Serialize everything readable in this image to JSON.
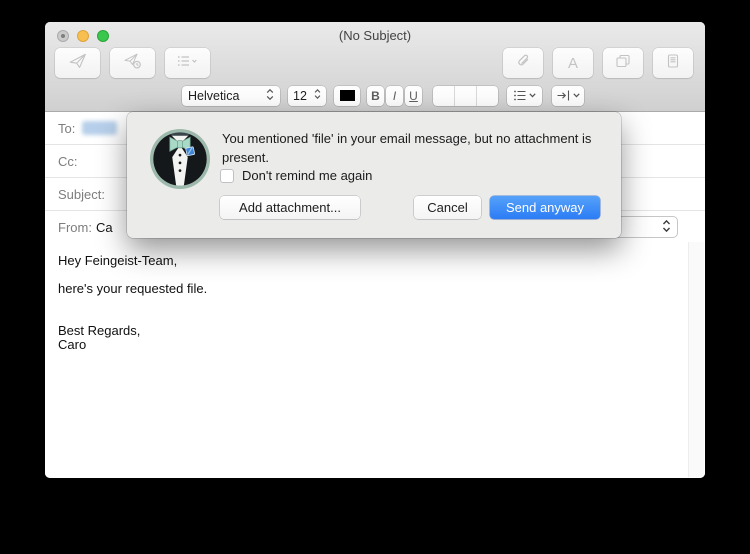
{
  "window": {
    "title": "(No Subject)"
  },
  "toolbar": {
    "buttons_left": [
      "send-icon",
      "send-later-icon",
      "lists-icon"
    ],
    "buttons_right": [
      "attach-icon",
      "fonts-icon",
      "photo-browser-icon",
      "stationery-icon"
    ]
  },
  "format_bar": {
    "font_family": "Helvetica",
    "font_size": "12",
    "bold_label": "B",
    "italic_label": "I",
    "underline_label": "U",
    "text_color": "#000000"
  },
  "headers": {
    "to_label": "To:",
    "to_recipient": "redacted-blurred-token",
    "cc_label": "Cc:",
    "subject_label": "Subject:",
    "from_label": "From:",
    "from_value_visible": "Ca"
  },
  "dialog": {
    "message": "You mentioned 'file' in your email message, but no attachment is present.",
    "checkbox_label": "Don't remind me again",
    "checkbox_checked": false,
    "add_attachment_label": "Add attachment...",
    "cancel_label": "Cancel",
    "send_anyway_label": "Send anyway",
    "accent_color": "#2e7df6",
    "avatar": "tuxedo-avatar-icon"
  },
  "message_body": {
    "lines": [
      "Hey Feingeist-Team,",
      "",
      "here's your requested file.",
      "",
      "",
      "Best Regards,",
      "Caro"
    ]
  }
}
